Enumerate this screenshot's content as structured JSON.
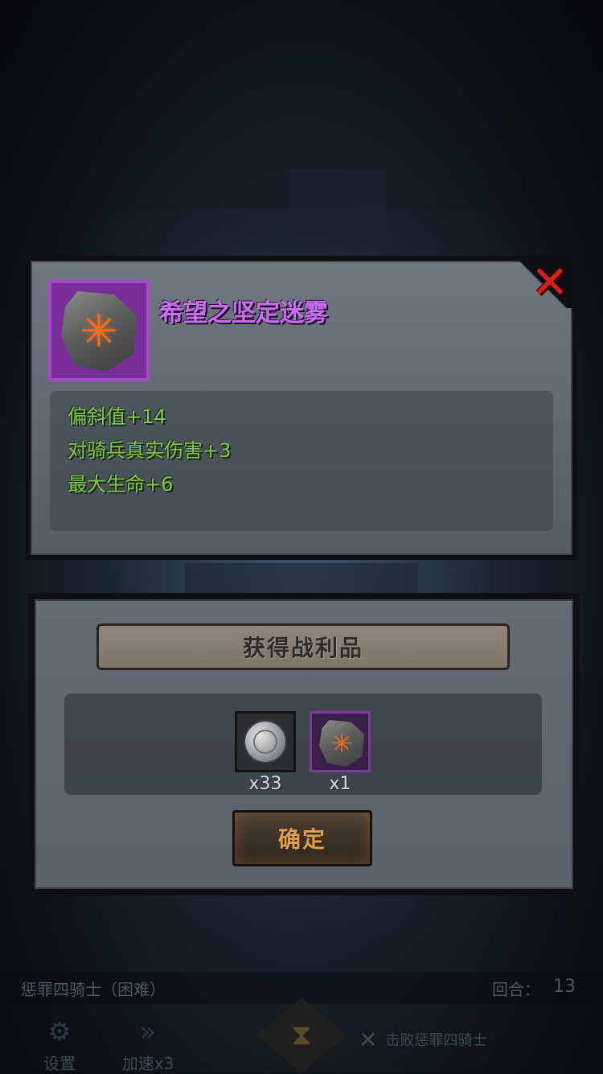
{
  "item_panel": {
    "item_name": "希望之坚定迷雾",
    "close_symbol": "✕",
    "rune_glyph": "✳",
    "stats": [
      "偏斜值+14",
      "对骑兵真实伤害+3",
      "最大生命+6"
    ]
  },
  "loot_panel": {
    "title": "获得战利品",
    "items": [
      {
        "name": "coin-icon",
        "quantity": "x33"
      },
      {
        "name": "rune-stone-icon",
        "glyph": "✳",
        "quantity": "x1"
      }
    ],
    "confirm_label": "确定"
  },
  "hud": {
    "stage_name": "惩罪四骑士（困难）",
    "round_label": "回合：",
    "round_value": "13",
    "settings_label": "设置",
    "settings_icon": "⚙",
    "speed_label": "加速x3",
    "speed_icon": "»",
    "hourglass_icon": "⧗",
    "objective_icon": "✕",
    "objective_text": "击败惩罪四骑士"
  },
  "colors": {
    "item_name": "#c86ef0",
    "stat_text": "#7fc94e",
    "close_x": "#d42020",
    "confirm_text": "#e0a04a",
    "rune_glow": "#ff6a1a"
  }
}
